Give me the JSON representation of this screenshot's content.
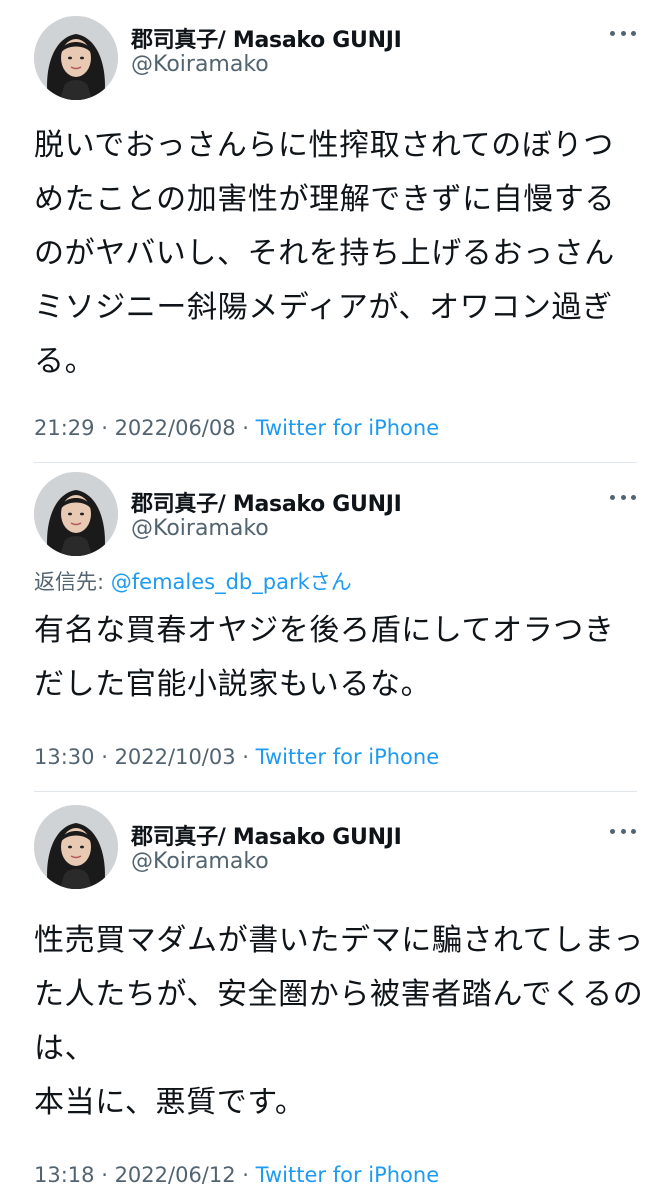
{
  "tweets": [
    {
      "author_name": "郡司真子/ Masako GUNJI",
      "author_handle": "@Koiramako",
      "reply_prefix": "",
      "reply_mention": "",
      "text": "脱いでおっさんらに性搾取されてのぼりつめたことの加害性が理解できずに自慢するのがヤバいし、それを持ち上げるおっさんミソジニー斜陽メディアが、オワコン過ぎる。",
      "time": "21:29",
      "date": "2022/06/08",
      "client": "Twitter for iPhone"
    },
    {
      "author_name": "郡司真子/ Masako GUNJI",
      "author_handle": "@Koiramako",
      "reply_prefix": "返信先: ",
      "reply_mention": "@females_db_parkさん",
      "text": "有名な買春オヤジを後ろ盾にしてオラつきだした官能小説家もいるな。",
      "time": "13:30",
      "date": "2022/10/03",
      "client": "Twitter for iPhone"
    },
    {
      "author_name": "郡司真子/ Masako GUNJI",
      "author_handle": "@Koiramako",
      "reply_prefix": "",
      "reply_mention": "",
      "text": "性売買マダムが書いたデマに騙されてしまった人たちが、安全圏から被害者踏んでくるのは、\n本当に、悪質です。",
      "time": "13:18",
      "date": "2022/06/12",
      "client": "Twitter for iPhone"
    }
  ],
  "meta_separator": " · ",
  "icons": {
    "avatar": "avatar-photo",
    "more": "more-horizontal-icon"
  },
  "colors": {
    "text": "#0f1419",
    "secondary": "#536471",
    "link": "#1d9bf0",
    "divider": "#e1e6ea"
  }
}
